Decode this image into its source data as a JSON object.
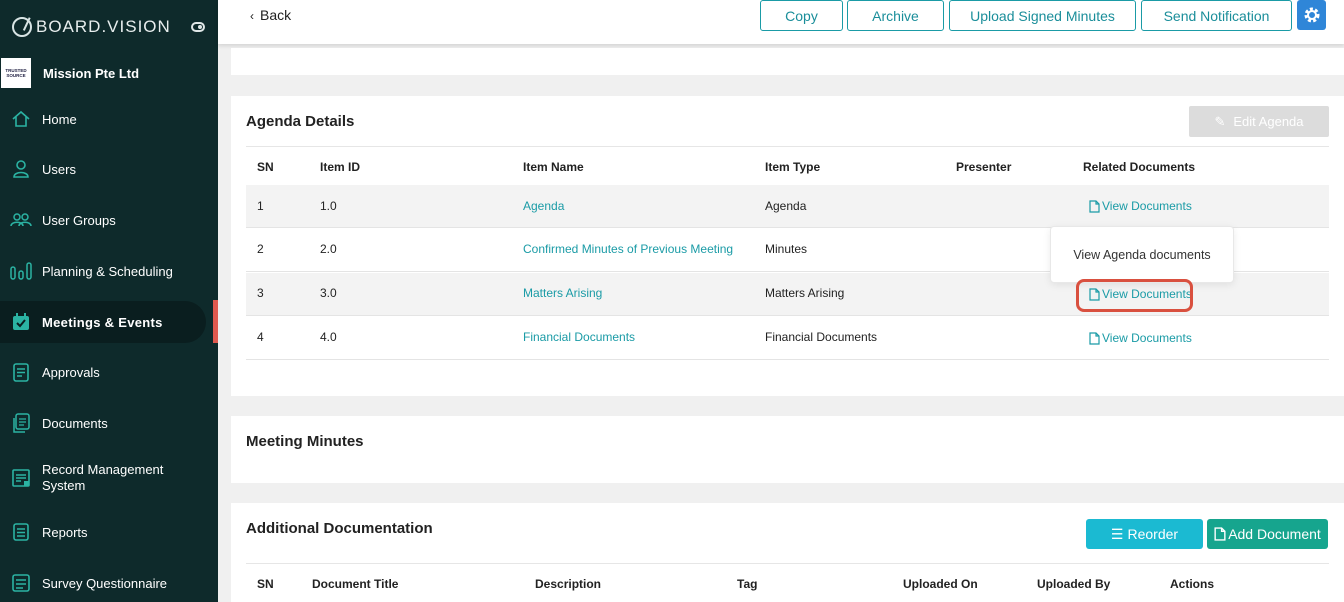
{
  "sidebar": {
    "brand": "BOARD.VISION",
    "org_logo": [
      "TRUSTED",
      "SOURCE"
    ],
    "org_name": "Mission Pte Ltd",
    "items": [
      {
        "label": "Home",
        "icon": "home-icon"
      },
      {
        "label": "Users",
        "icon": "user-icon"
      },
      {
        "label": "User Groups",
        "icon": "user-group-icon"
      },
      {
        "label": "Planning & Scheduling",
        "icon": "chart-icon"
      },
      {
        "label": "Meetings & Events",
        "icon": "calendar-icon",
        "active": true
      },
      {
        "label": "Approvals",
        "icon": "approval-doc-icon"
      },
      {
        "label": "Documents",
        "icon": "documents-icon"
      },
      {
        "label": "Record Management",
        "label2": "System",
        "icon": "record-icon"
      },
      {
        "label": "Reports",
        "icon": "report-icon"
      },
      {
        "label": "Survey Questionnaire",
        "icon": "survey-icon"
      }
    ]
  },
  "topbar": {
    "back_label": "Back",
    "buttons": [
      "Copy",
      "Archive",
      "Upload Signed Minutes",
      "Send Notification"
    ]
  },
  "agenda": {
    "title": "Agenda Details",
    "edit_label": "Edit Agenda",
    "headers": [
      "SN",
      "Item ID",
      "Item Name",
      "Item Type",
      "Presenter",
      "Related Documents"
    ],
    "rows": [
      {
        "sn": "1",
        "id": "1.0",
        "name": "Agenda",
        "type": "Agenda",
        "presenter": "",
        "docs": "View Documents"
      },
      {
        "sn": "2",
        "id": "2.0",
        "name": "Confirmed Minutes of Previous Meeting",
        "type": "Minutes",
        "presenter": "",
        "docs": ""
      },
      {
        "sn": "3",
        "id": "3.0",
        "name": "Matters Arising",
        "type": "Matters Arising",
        "presenter": "",
        "docs": "View Documents"
      },
      {
        "sn": "4",
        "id": "4.0",
        "name": "Financial Documents",
        "type": "Financial Documents",
        "presenter": "",
        "docs": "View Documents"
      }
    ],
    "tooltip": "View Agenda documents"
  },
  "minutes": {
    "title": "Meeting Minutes"
  },
  "additional": {
    "title": "Additional Documentation",
    "reorder_label": "Reorder",
    "add_label": "Add Document",
    "headers": [
      "SN",
      "Document Title",
      "Description",
      "Tag",
      "Uploaded On",
      "Uploaded By",
      "Actions"
    ]
  },
  "colors": {
    "sidebar_bg": "#0e2a2b",
    "accent": "#1a9ba6",
    "active_bar": "#e05a4f",
    "highlight": "#d9503f"
  }
}
